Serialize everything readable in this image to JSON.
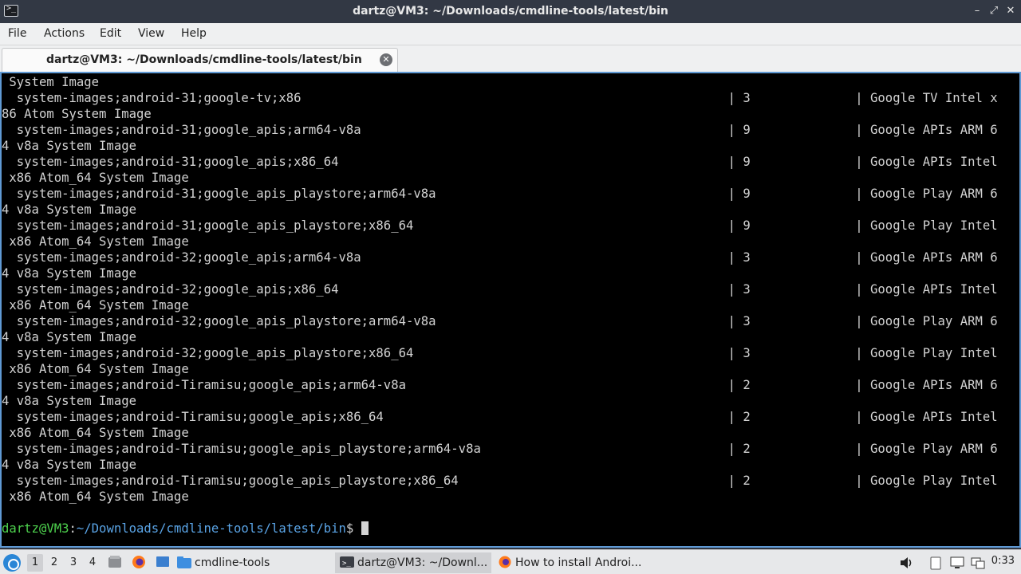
{
  "window": {
    "title": "dartz@VM3: ~/Downloads/cmdline-tools/latest/bin",
    "app_icon_glyph": ">_",
    "controls": {
      "minimize": "–",
      "maximize": "⤢",
      "close": "✕"
    }
  },
  "menu": {
    "file": "File",
    "actions": "Actions",
    "edit": "Edit",
    "view": "View",
    "help": "Help"
  },
  "tab": {
    "label": "dartz@VM3: ~/Downloads/cmdline-tools/latest/bin",
    "close_glyph": "✕"
  },
  "terminal": {
    "lines": [
      " System Image",
      "  system-images;android-31;google-tv;x86                                                         | 3              | Google TV Intel x",
      "86 Atom System Image",
      "  system-images;android-31;google_apis;arm64-v8a                                                 | 9              | Google APIs ARM 6",
      "4 v8a System Image",
      "  system-images;android-31;google_apis;x86_64                                                    | 9              | Google APIs Intel",
      " x86 Atom_64 System Image",
      "  system-images;android-31;google_apis_playstore;arm64-v8a                                       | 9              | Google Play ARM 6",
      "4 v8a System Image",
      "  system-images;android-31;google_apis_playstore;x86_64                                          | 9              | Google Play Intel",
      " x86 Atom_64 System Image",
      "  system-images;android-32;google_apis;arm64-v8a                                                 | 3              | Google APIs ARM 6",
      "4 v8a System Image",
      "  system-images;android-32;google_apis;x86_64                                                    | 3              | Google APIs Intel",
      " x86 Atom_64 System Image",
      "  system-images;android-32;google_apis_playstore;arm64-v8a                                       | 3              | Google Play ARM 6",
      "4 v8a System Image",
      "  system-images;android-32;google_apis_playstore;x86_64                                          | 3              | Google Play Intel",
      " x86 Atom_64 System Image",
      "  system-images;android-Tiramisu;google_apis;arm64-v8a                                           | 2              | Google APIs ARM 6",
      "4 v8a System Image",
      "  system-images;android-Tiramisu;google_apis;x86_64                                              | 2              | Google APIs Intel",
      " x86 Atom_64 System Image",
      "  system-images;android-Tiramisu;google_apis_playstore;arm64-v8a                                 | 2              | Google Play ARM 6",
      "4 v8a System Image",
      "  system-images;android-Tiramisu;google_apis_playstore;x86_64                                    | 2              | Google Play Intel",
      " x86 Atom_64 System Image",
      ""
    ],
    "prompt": {
      "user_host": "dartz@VM3",
      "separator": ":",
      "path": "~/Downloads/cmdline-tools/latest/bin",
      "symbol": "$ "
    }
  },
  "taskbar": {
    "workspaces": [
      "1",
      "2",
      "3",
      "4"
    ],
    "active_workspace": "1",
    "tasks": [
      {
        "label": "cmdline-tools",
        "icon": "folder-icon"
      },
      {
        "label": "dartz@VM3: ~/Downl...",
        "icon": "terminal-icon"
      },
      {
        "label": "How to install Androi...",
        "icon": "firefox-icon"
      }
    ],
    "clock": "0:33"
  },
  "colors": {
    "terminal_bg": "#000000",
    "terminal_fg": "#d3d3d3",
    "prompt_user": "#4ed34e",
    "prompt_path": "#5aa4e6",
    "titlebar_bg": "#323844",
    "terminal_border": "#5f99d4"
  }
}
